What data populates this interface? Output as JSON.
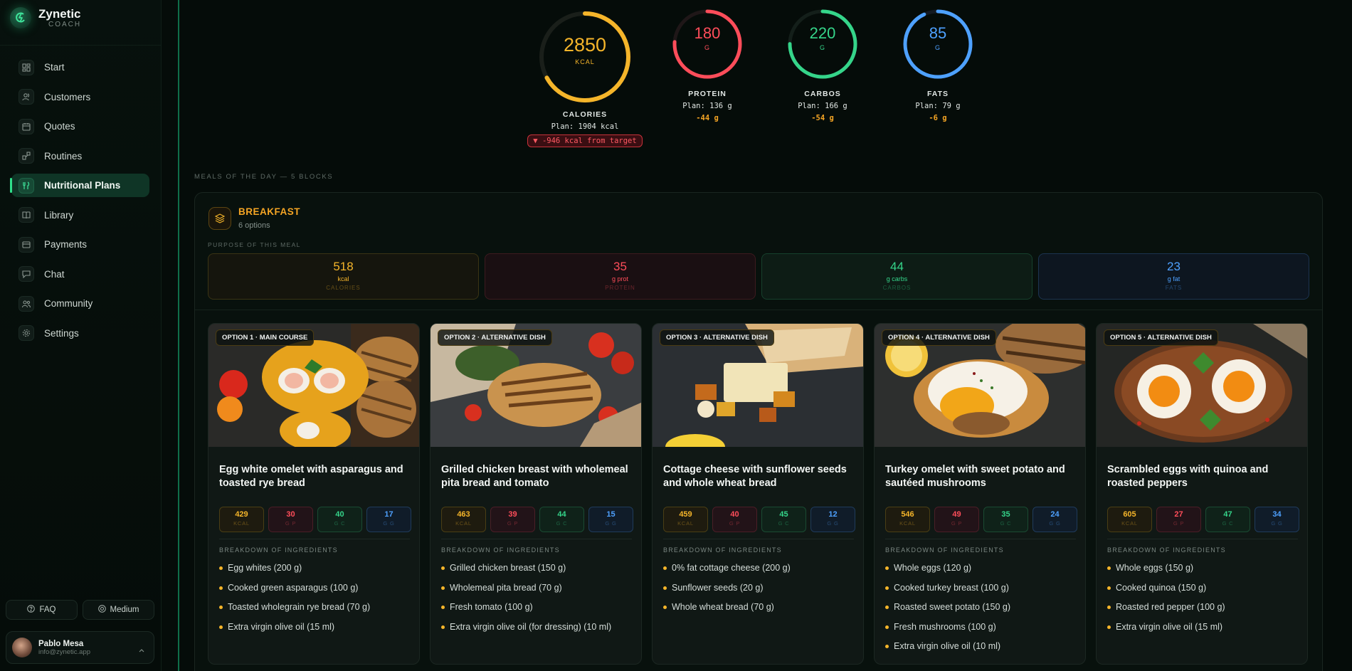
{
  "brand": {
    "name": "Zynetic",
    "subtitle": "COACH"
  },
  "sidebar": {
    "items": [
      {
        "label": "Start",
        "icon": "grid-icon"
      },
      {
        "label": "Customers",
        "icon": "users-icon"
      },
      {
        "label": "Quotes",
        "icon": "calendar-icon"
      },
      {
        "label": "Routines",
        "icon": "routine-icon"
      },
      {
        "label": "Nutritional Plans",
        "icon": "utensils-icon",
        "active": true
      },
      {
        "label": "Library",
        "icon": "book-icon"
      },
      {
        "label": "Payments",
        "icon": "card-icon"
      },
      {
        "label": "Chat",
        "icon": "chat-icon"
      },
      {
        "label": "Community",
        "icon": "community-icon"
      },
      {
        "label": "Settings",
        "icon": "gear-icon"
      }
    ],
    "faq_label": "FAQ",
    "theme_label": "Medium",
    "user": {
      "name": "Pablo Mesa",
      "email": "info@zynetic.app"
    }
  },
  "summary": {
    "calories": {
      "value": "2850",
      "unit": "KCAL",
      "label": "CALORIES",
      "plan": "Plan: 1904 kcal",
      "badge": "▼ -946 kcal from target",
      "color": "#f5b52a",
      "fill": 0.67
    },
    "protein": {
      "value": "180",
      "unit": "G",
      "label": "PROTEIN",
      "plan": "Plan: 136 g",
      "diff": "-44 g",
      "color": "#ff4d5a",
      "fill": 0.76
    },
    "carbs": {
      "value": "220",
      "unit": "G",
      "label": "CARBOS",
      "plan": "Plan: 166 g",
      "diff": "-54 g",
      "color": "#35d58a",
      "fill": 0.75
    },
    "fats": {
      "value": "85",
      "unit": "G",
      "label": "FATS",
      "plan": "Plan: 79 g",
      "diff": "-6 g",
      "color": "#4ea1ff",
      "fill": 0.93
    }
  },
  "meals_caption": "MEALS OF THE DAY — 5 BLOCKS",
  "meal": {
    "title": "BREAKFAST",
    "options": "6 options",
    "purpose_caption": "PURPOSE OF THIS MEAL",
    "targets": {
      "kcal": {
        "value": "518",
        "unit": "kcal",
        "label": "CALORIES"
      },
      "prot": {
        "value": "35",
        "unit": "g prot",
        "label": "PROTEIN"
      },
      "carb": {
        "value": "44",
        "unit": "g carbs",
        "label": "CARBOS"
      },
      "fat": {
        "value": "23",
        "unit": "g fat",
        "label": "FATS"
      }
    },
    "ingredients_caption": "BREAKDOWN OF INGREDIENTS",
    "cards": [
      {
        "badge": "OPTION 1 · MAIN COURSE",
        "title": "Egg white omelet with asparagus and toasted rye bread",
        "macros": {
          "kcal": "429",
          "kcal_l": "KCAL",
          "p": "30",
          "p_l": "G P",
          "c": "40",
          "c_l": "G C",
          "f": "17",
          "f_l": "G G"
        },
        "ingredients": [
          "Egg whites (200 g)",
          "Cooked green asparagus (100 g)",
          "Toasted wholegrain rye bread (70 g)",
          "Extra virgin olive oil (15 ml)"
        ]
      },
      {
        "badge": "OPTION 2 · ALTERNATIVE DISH",
        "title": "Grilled chicken breast with wholemeal pita bread and tomato",
        "macros": {
          "kcal": "463",
          "kcal_l": "KCAL",
          "p": "39",
          "p_l": "G P",
          "c": "44",
          "c_l": "G C",
          "f": "15",
          "f_l": "G G"
        },
        "ingredients": [
          "Grilled chicken breast (150 g)",
          "Wholemeal pita bread (70 g)",
          "Fresh tomato (100 g)",
          "Extra virgin olive oil (for dressing) (10 ml)"
        ]
      },
      {
        "badge": "OPTION 3 · ALTERNATIVE DISH",
        "title": "Cottage cheese with sunflower seeds and whole wheat bread",
        "macros": {
          "kcal": "459",
          "kcal_l": "KCAL",
          "p": "40",
          "p_l": "G P",
          "c": "45",
          "c_l": "G C",
          "f": "12",
          "f_l": "G G"
        },
        "ingredients": [
          "0% fat cottage cheese (200 g)",
          "Sunflower seeds (20 g)",
          "Whole wheat bread (70 g)"
        ]
      },
      {
        "badge": "OPTION 4 · ALTERNATIVE DISH",
        "title": "Turkey omelet with sweet potato and sautéed mushrooms",
        "macros": {
          "kcal": "546",
          "kcal_l": "KCAL",
          "p": "49",
          "p_l": "G P",
          "c": "35",
          "c_l": "G C",
          "f": "24",
          "f_l": "G G"
        },
        "ingredients": [
          "Whole eggs (120 g)",
          "Cooked turkey breast (100 g)",
          "Roasted sweet potato (150 g)",
          "Fresh mushrooms (100 g)",
          "Extra virgin olive oil (10 ml)"
        ]
      },
      {
        "badge": "OPTION 5 · ALTERNATIVE DISH",
        "title": "Scrambled eggs with quinoa and roasted peppers",
        "macros": {
          "kcal": "605",
          "kcal_l": "KCAL",
          "p": "27",
          "p_l": "G P",
          "c": "47",
          "c_l": "G C",
          "f": "34",
          "f_l": "G G"
        },
        "ingredients": [
          "Whole eggs (150 g)",
          "Cooked quinoa (150 g)",
          "Roasted red pepper (100 g)",
          "Extra virgin olive oil (15 ml)"
        ]
      }
    ]
  }
}
